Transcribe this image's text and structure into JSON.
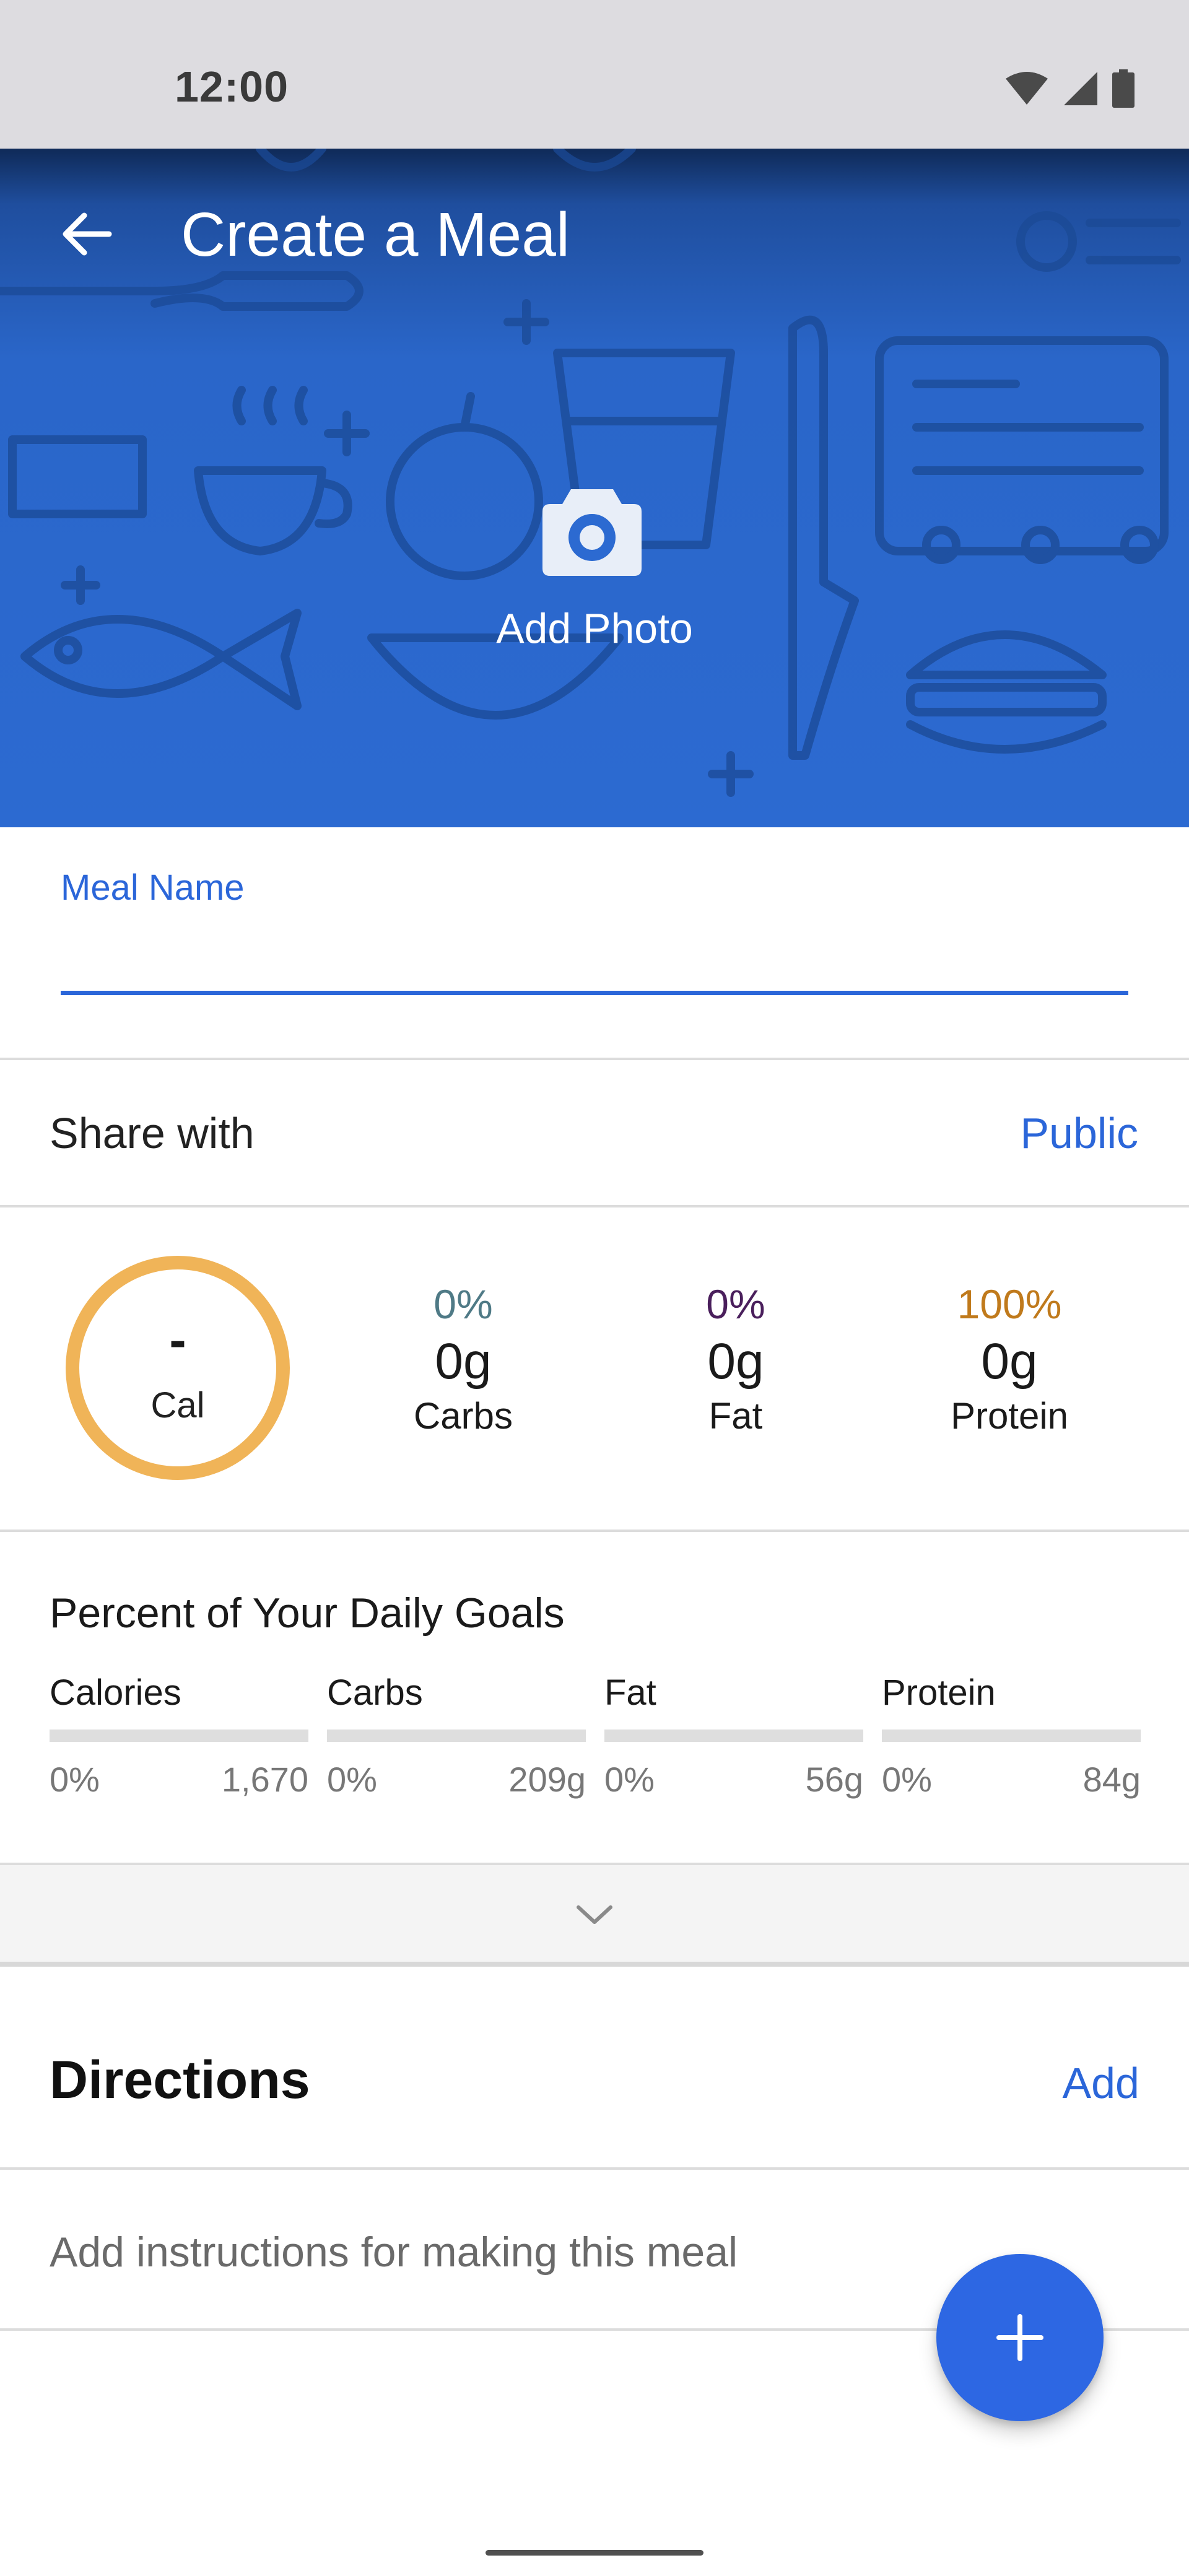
{
  "status_bar": {
    "time": "12:00",
    "icons": [
      "wifi-icon",
      "cellular-signal-icon",
      "battery-icon"
    ]
  },
  "header": {
    "title": "Create a Meal",
    "add_photo_label": "Add Photo",
    "icons": [
      "back-arrow-icon",
      "camera-icon"
    ]
  },
  "meal_name": {
    "label": "Meal Name",
    "value": ""
  },
  "share": {
    "label": "Share with",
    "value": "Public"
  },
  "nutrition": {
    "calories": {
      "value": "-",
      "label": "Cal"
    },
    "macros": [
      {
        "percent": "0%",
        "grams": "0g",
        "name": "Carbs",
        "color": "#4f7a86"
      },
      {
        "percent": "0%",
        "grams": "0g",
        "name": "Fat",
        "color": "#4a1f5c"
      },
      {
        "percent": "100%",
        "grams": "0g",
        "name": "Protein",
        "color": "#c07a1c"
      }
    ],
    "ring_color": "#f0b458"
  },
  "daily_goals": {
    "title": "Percent of Your Daily Goals",
    "items": [
      {
        "name": "Calories",
        "percent": "0%",
        "goal": "1,670",
        "progress": 0
      },
      {
        "name": "Carbs",
        "percent": "0%",
        "goal": "209g",
        "progress": 0
      },
      {
        "name": "Fat",
        "percent": "0%",
        "goal": "56g",
        "progress": 0
      },
      {
        "name": "Protein",
        "percent": "0%",
        "goal": "84g",
        "progress": 0
      }
    ]
  },
  "directions": {
    "title": "Directions",
    "add_label": "Add",
    "placeholder": "Add instructions for making this meal"
  },
  "colors": {
    "accent": "#2b66d9",
    "header_blue": "#2c6ad1",
    "fab": "#2d67e3"
  }
}
